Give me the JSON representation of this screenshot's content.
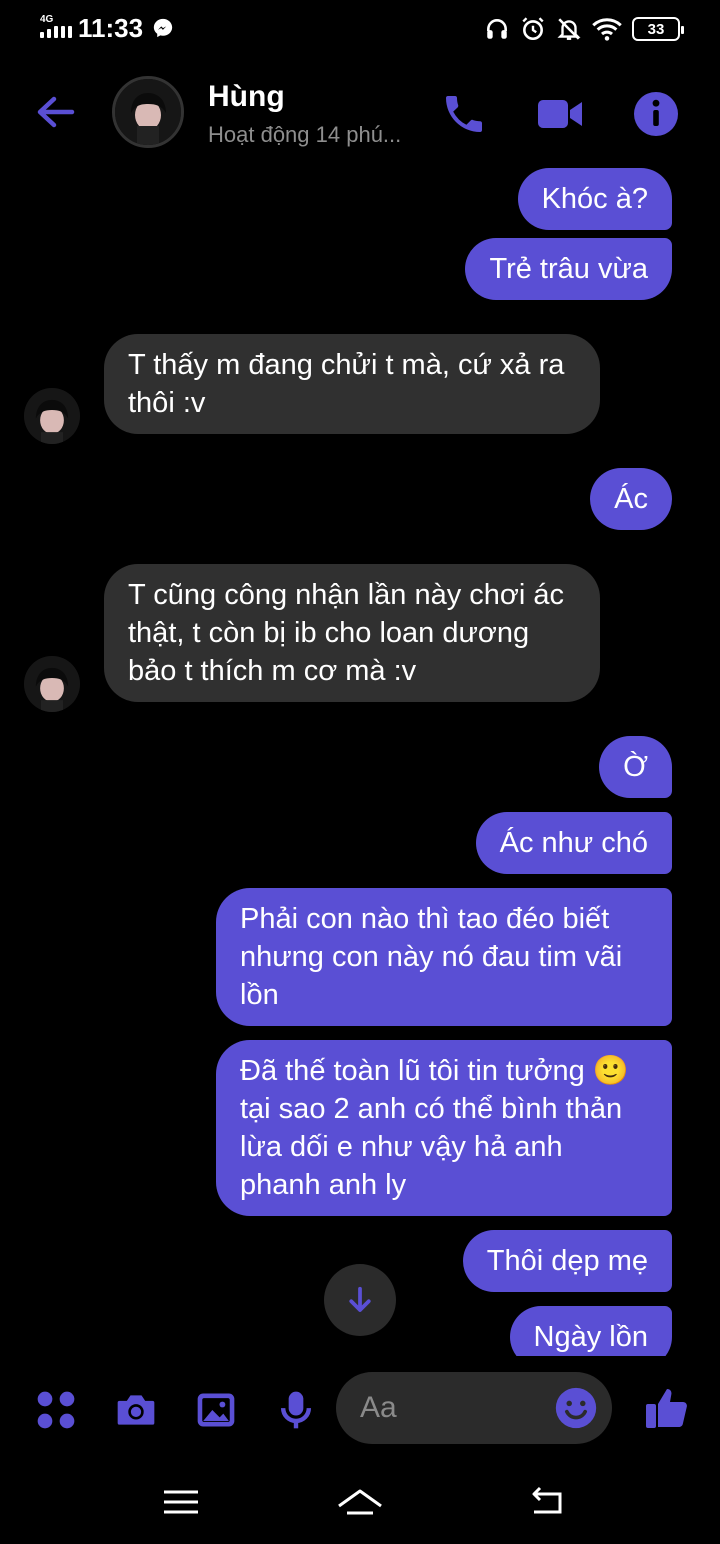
{
  "status_bar": {
    "network": "4G",
    "time": "11:33",
    "battery": "33"
  },
  "header": {
    "name": "Hùng",
    "activity": "Hoạt động 14 phú..."
  },
  "messages": [
    {
      "from": "me",
      "text": "Khóc à?"
    },
    {
      "from": "me",
      "text": "Trẻ trâu vừa"
    },
    {
      "from": "them",
      "text": "T thấy m đang chửi t mà, cứ xả ra thôi :v"
    },
    {
      "from": "me",
      "text": "Ác"
    },
    {
      "from": "them",
      "text": "T cũng công nhận lần này chơi ác thật, t còn bị ib cho loan dương bảo t thích m cơ mà :v"
    },
    {
      "from": "me",
      "text": "Ờ"
    },
    {
      "from": "me",
      "text": "Ác như chó"
    },
    {
      "from": "me",
      "text": "Phải con nào thì tao đéo biết nhưng con này nó đau tim vãi lồn"
    },
    {
      "from": "me",
      "text": "Đã thế toàn lũ tôi tin tưởng 🙂 tại sao 2 anh có thể bình thản lừa dối e như vậy hả anh phanh anh ly"
    },
    {
      "from": "me",
      "text": "Thôi dẹp mẹ"
    },
    {
      "from": "me",
      "text": "Ngày lồn"
    }
  ],
  "composer": {
    "placeholder": "Aa"
  },
  "colors": {
    "accent": "#5a4fd4",
    "incoming_bubble": "#303030",
    "background": "#000000"
  }
}
